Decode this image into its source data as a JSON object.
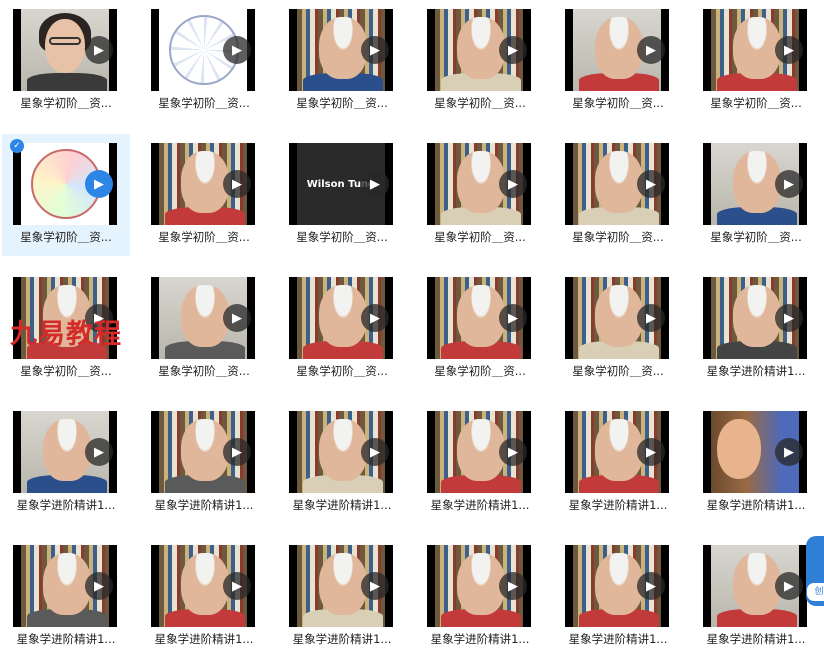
{
  "caption_basic": "星象学初阶＿资...",
  "caption_advanced": "星象学进阶精讲1...",
  "watermark": "九易教程",
  "side_widget_label": "创",
  "accent_color": "#2d86e6",
  "rows": [
    [
      {
        "type": "woman",
        "caption": "basic"
      },
      {
        "type": "chart",
        "caption": "basic"
      },
      {
        "type": "man",
        "shirt": "#2b4f8a",
        "bg": "shelf",
        "caption": "basic"
      },
      {
        "type": "man",
        "shirt": "#d9cfb6",
        "bg": "shelf",
        "caption": "basic"
      },
      {
        "type": "man",
        "shirt": "#c33a3a",
        "bg": "wall",
        "caption": "basic"
      },
      {
        "type": "man",
        "shirt": "#c33a3a",
        "bg": "shelf",
        "caption": "basic"
      }
    ],
    [
      {
        "type": "chart-color",
        "caption": "basic",
        "selected": true
      },
      {
        "type": "man",
        "shirt": "#c33a3a",
        "bg": "shelf",
        "caption": "basic"
      },
      {
        "type": "wilson",
        "text": "Wilson Tung",
        "caption": "basic"
      },
      {
        "type": "man",
        "shirt": "#d9cfb6",
        "bg": "shelf",
        "caption": "basic"
      },
      {
        "type": "man",
        "shirt": "#d9cfb6",
        "bg": "shelf",
        "caption": "basic"
      },
      {
        "type": "man",
        "shirt": "#2b4f8a",
        "bg": "wall",
        "caption": "basic"
      }
    ],
    [
      {
        "type": "man",
        "shirt": "#c33a3a",
        "bg": "shelf",
        "caption": "basic"
      },
      {
        "type": "man",
        "shirt": "#5a5a5a",
        "bg": "wall",
        "caption": "basic"
      },
      {
        "type": "man",
        "shirt": "#c33a3a",
        "bg": "shelf",
        "caption": "basic"
      },
      {
        "type": "man",
        "shirt": "#c33a3a",
        "bg": "shelf",
        "caption": "basic"
      },
      {
        "type": "man",
        "shirt": "#d9cfb6",
        "bg": "shelf",
        "caption": "basic"
      },
      {
        "type": "man",
        "shirt": "#444444",
        "bg": "shelf",
        "caption": "advanced"
      }
    ],
    [
      {
        "type": "man",
        "shirt": "#2b4f8a",
        "bg": "wall",
        "caption": "advanced"
      },
      {
        "type": "man",
        "shirt": "#5a5a5a",
        "bg": "shelf",
        "caption": "advanced"
      },
      {
        "type": "man",
        "shirt": "#d9cfb6",
        "bg": "shelf",
        "caption": "advanced"
      },
      {
        "type": "man",
        "shirt": "#c33a3a",
        "bg": "shelf",
        "caption": "advanced"
      },
      {
        "type": "man",
        "shirt": "#c33a3a",
        "bg": "shelf",
        "caption": "advanced"
      },
      {
        "type": "child",
        "caption": "advanced"
      }
    ],
    [
      {
        "type": "man",
        "shirt": "#5a5a5a",
        "bg": "shelf",
        "caption": "advanced"
      },
      {
        "type": "man",
        "shirt": "#c33a3a",
        "bg": "shelf",
        "caption": "advanced"
      },
      {
        "type": "man",
        "shirt": "#d9cfb6",
        "bg": "shelf",
        "caption": "advanced"
      },
      {
        "type": "man",
        "shirt": "#c33a3a",
        "bg": "shelf",
        "caption": "advanced"
      },
      {
        "type": "man",
        "shirt": "#c33a3a",
        "bg": "shelf",
        "caption": "advanced"
      },
      {
        "type": "man",
        "shirt": "#c33a3a",
        "bg": "wall",
        "caption": "advanced"
      }
    ]
  ]
}
